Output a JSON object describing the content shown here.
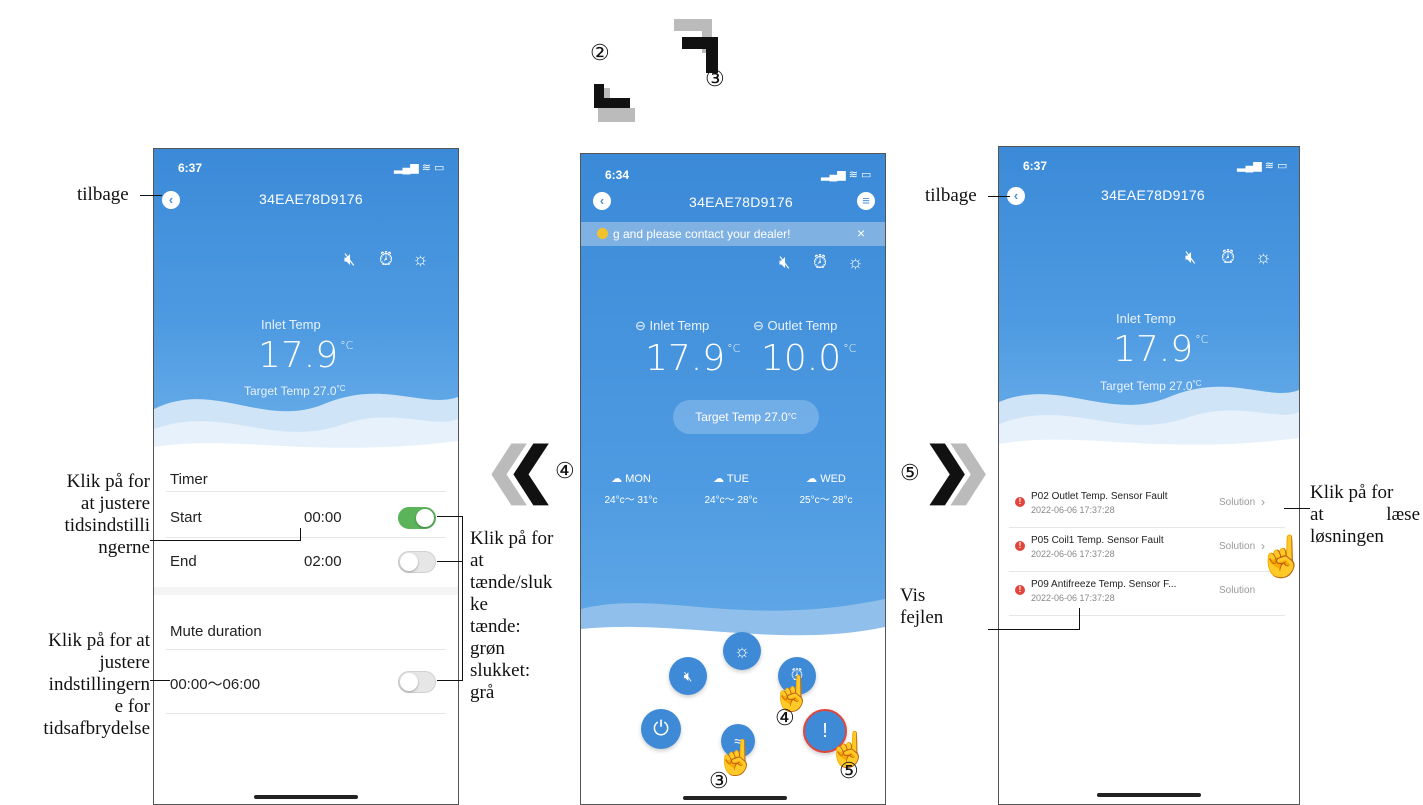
{
  "colors": {
    "app_blue": "#3b8ad8",
    "toggle_on": "#5bb35a",
    "toggle_off": "#e6e6e6",
    "fault_red": "#e0463c"
  },
  "nav_steps": {
    "step2": "②",
    "step3": "③",
    "step4": "④",
    "step5": "⑤"
  },
  "phone_left": {
    "time": "6:37",
    "device_id": "34EAE78D9176",
    "inlet_label": "Inlet Temp",
    "inlet_value": "17.9",
    "unit": "°C",
    "target_label": "Target Temp",
    "target_value": "27.0",
    "target_unit": "°C",
    "timer_header": "Timer",
    "start_label": "Start",
    "start_time": "00:00",
    "start_on": true,
    "end_label": "End",
    "end_time": "02:00",
    "end_on": false,
    "mute_header": "Mute duration",
    "mute_range": "00:00～06:00",
    "mute_on": false,
    "icons": [
      "mute-icon",
      "alarm-icon",
      "sun-icon"
    ]
  },
  "phone_center": {
    "time": "6:34",
    "device_id": "34EAE78D9176",
    "banner": "g and please contact your dealer!",
    "banner_close": "×",
    "inlet_label": "Inlet Temp",
    "inlet_value": "17.9",
    "outlet_label": "Outlet Temp",
    "outlet_value": "10.0",
    "unit": "°C",
    "target_label": "Target Temp",
    "target_value": "27.0",
    "target_unit": "°C",
    "weather": [
      {
        "day": "MON",
        "range": "24°c～ 31°c"
      },
      {
        "day": "TUE",
        "range": "24°c～ 28°c"
      },
      {
        "day": "WED",
        "range": "25°c～ 28°c"
      }
    ],
    "hand_labels": {
      "h3": "③",
      "h4": "④",
      "h5": "⑤"
    }
  },
  "phone_right": {
    "time": "6:37",
    "device_id": "34EAE78D9176",
    "inlet_label": "Inlet Temp",
    "inlet_value": "17.9",
    "unit": "°C",
    "target_label": "Target Temp",
    "target_value": "27.0",
    "target_unit": "°C",
    "faults": [
      {
        "title": "P02 Outlet Temp. Sensor Fault",
        "date": "2022-06-06 17:37:28",
        "action": "Solution"
      },
      {
        "title": "P05 Coil1 Temp. Sensor Fault",
        "date": "2022-06-06 17:37:28",
        "action": "Solution"
      },
      {
        "title": "P09 Antifreeze Temp. Sensor F...",
        "date": "2022-06-06 17:37:28",
        "action": "Solution"
      }
    ]
  },
  "annotations": {
    "back_left": "tilbage",
    "back_right": "tilbage",
    "timer_hint": [
      "Klik på for",
      "at justere",
      "tidsindstilli",
      "ngerne"
    ],
    "toggle_hint": [
      "Klik på for",
      "at",
      "tænde/sluk",
      "ke",
      "tænde:",
      "grøn",
      "slukket:",
      "grå"
    ],
    "mute_hint": [
      "Klik på for at",
      "justere",
      "indstillingern",
      "e for",
      "tidsafbrydelse"
    ],
    "solution_hint_line1": "Klik på for",
    "solution_hint_line2": [
      "at",
      "læse"
    ],
    "solution_hint_line3": "løsningen",
    "fault_hint": [
      "Vis",
      "fejlen"
    ]
  }
}
